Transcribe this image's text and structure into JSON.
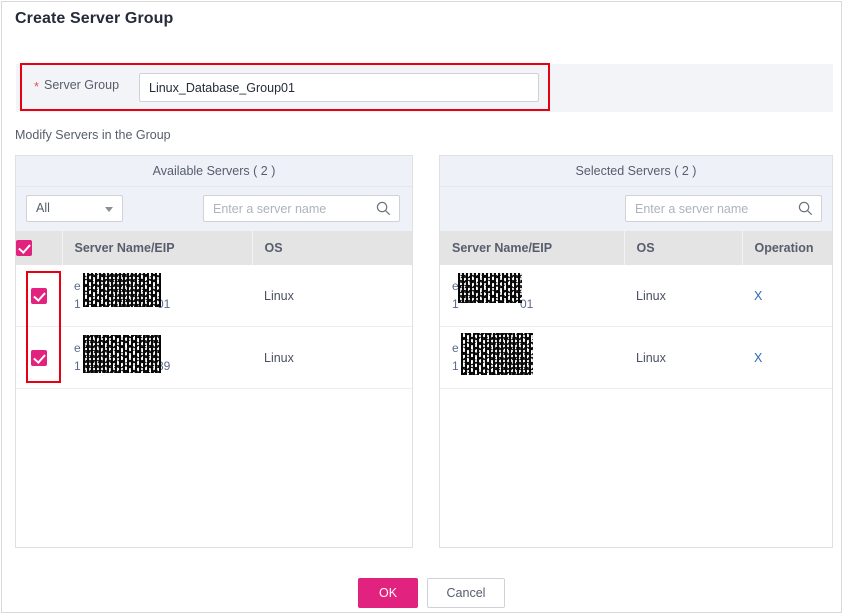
{
  "dialog": {
    "title": "Create Server Group",
    "section_label": "Modify Servers in the Group"
  },
  "form": {
    "required_marker": "*",
    "label": "Server Group",
    "value": "Linux_Database_Group01",
    "placeholder": ""
  },
  "available_panel": {
    "header": "Available Servers ( 2 )",
    "filter_value": "All",
    "search_placeholder": "Enter a server name",
    "columns": [
      "Server Name/EIP",
      "OS"
    ],
    "rows": [
      {
        "name_prefix": "e",
        "ip_prefix": "1",
        "ip_suffix": "01",
        "os": "Linux",
        "checked": true
      },
      {
        "name_prefix": "e",
        "ip_prefix": "1",
        "ip_suffix": "39",
        "os": "Linux",
        "checked": true
      }
    ]
  },
  "selected_panel": {
    "header": "Selected Servers ( 2 )",
    "search_placeholder": "Enter a server name",
    "columns": [
      "Server Name/EIP",
      "OS",
      "Operation"
    ],
    "rows": [
      {
        "name_prefix": "e",
        "ip_prefix": "1",
        "ip_suffix": "01",
        "os": "Linux",
        "operation": "X"
      },
      {
        "name_prefix": "e",
        "ip_prefix": "1",
        "ip_suffix": "",
        "os": "Linux",
        "operation": "X"
      }
    ]
  },
  "footer": {
    "ok_label": "OK",
    "cancel_label": "Cancel"
  },
  "icons": {
    "search": "search-icon",
    "chevron": "chevron-down-icon",
    "check": "check-icon"
  },
  "colors": {
    "accent": "#e2227f",
    "annotation": "#e60012",
    "required": "#e8515a",
    "link": "#2b6cb0",
    "panel_header_bg": "#eef1f8",
    "table_header_bg": "#e4e4e4",
    "form_strip_bg": "#f2f4f7"
  }
}
